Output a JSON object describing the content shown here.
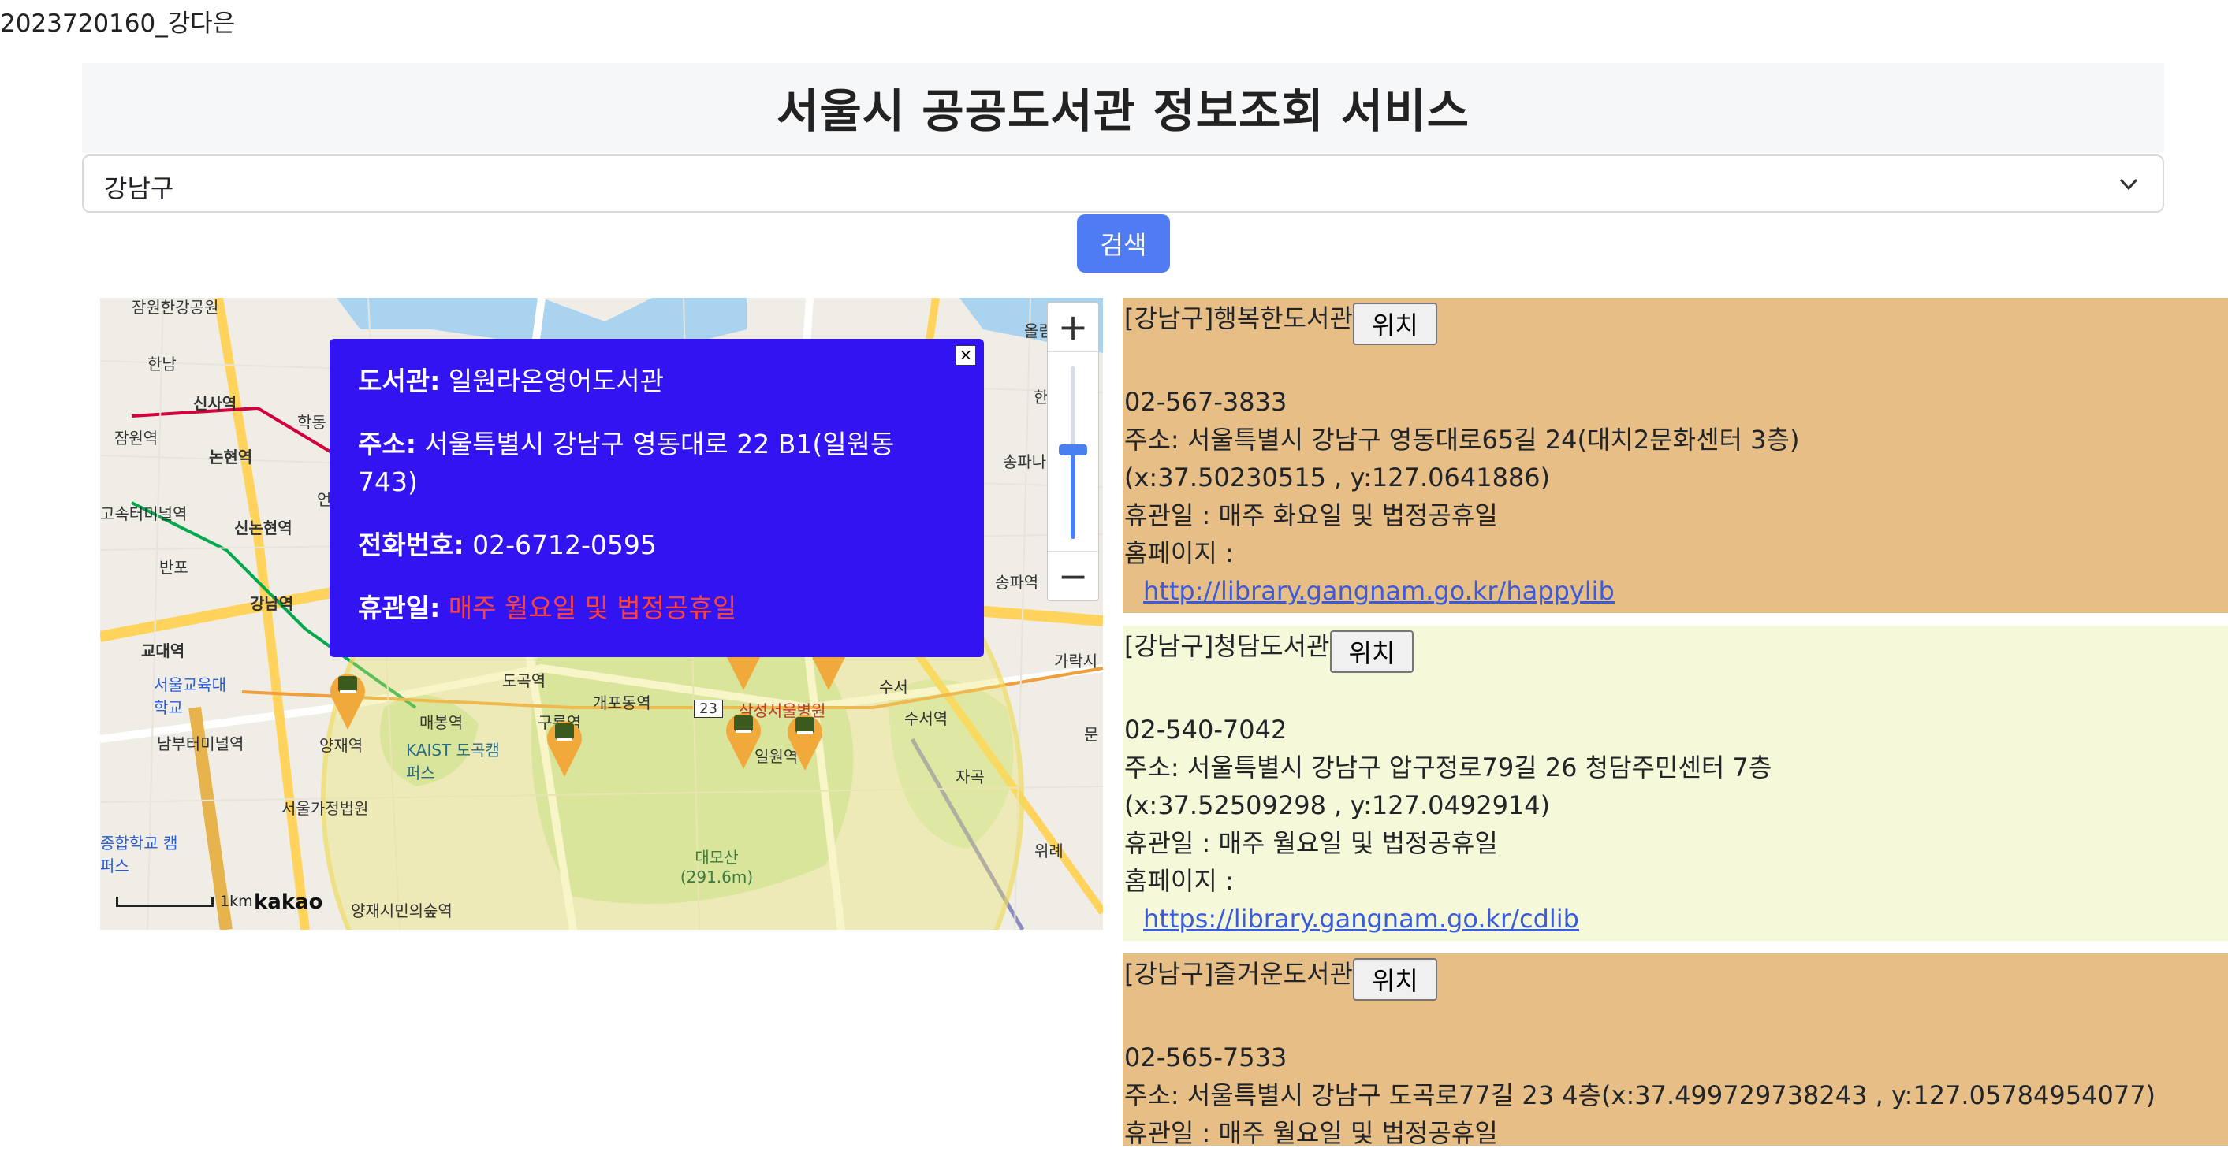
{
  "student": "2023720160_강다은",
  "header": {
    "title": "서울시 공공도서관 정보조회 서비스"
  },
  "district_select": {
    "value": "강남구",
    "chevron_icon": "chevron-down-icon"
  },
  "search_button": {
    "label": "검색"
  },
  "map": {
    "labels": [
      "잠원한강공원",
      "한남",
      "신사역",
      "학동",
      "잠원역",
      "논현역",
      "고속터미널역",
      "신논현역",
      "언",
      "반포",
      "강남역",
      "교대역",
      "서울교육대학교",
      "남부터미널역",
      "양재역",
      "서울가정법원",
      "KAIST 도곡캠퍼스",
      "매봉역",
      "도곡역",
      "구룡역",
      "개포동역",
      "삼성서울병원",
      "일원역",
      "수서역",
      "수서",
      "자곡",
      "가락시",
      "송파역",
      "송파나루",
      "위례",
      "대모산 (291.6m)",
      "양재시민의숲역",
      "문",
      "올림",
      "한",
      "종합학교 캠퍼스",
      "23"
    ],
    "scale_label": "1km",
    "brand": "kakao",
    "zoom_in_icon": "plus-icon",
    "zoom_out_icon": "minus-icon"
  },
  "popup": {
    "library_label": "도서관:",
    "library": "일원라온영어도서관",
    "address_label": "주소:",
    "address": "서울특별시 강남구 영동대로 22 B1(일원동 743)",
    "phone_label": "전화번호:",
    "phone": "02-6712-0595",
    "closed_label": "휴관일:",
    "closed": "매주 월요일 및 법정공휴일",
    "close_icon": "close-icon"
  },
  "libraries": [
    {
      "name": "[강남구]행복한도서관",
      "button": "위치",
      "phone": "02-567-3833",
      "address": "주소: 서울특별시 강남구 영동대로65길 24(대치2문화센터 3층)",
      "coords": "(x:37.50230515 , y:127.0641886)",
      "closed": "휴관일 : 매주 화요일 및 법정공휴일",
      "homepage_label": "홈페이지 :",
      "homepage": "http://library.gangnam.go.kr/happylib",
      "color": "#e6be86"
    },
    {
      "name": "[강남구]청담도서관",
      "button": "위치",
      "phone": "02-540-7042",
      "address": "주소: 서울특별시 강남구 압구정로79길 26 청담주민센터 7층",
      "coords": "(x:37.52509298 , y:127.0492914)",
      "closed": "휴관일 : 매주 월요일 및 법정공휴일",
      "homepage_label": "홈페이지 :",
      "homepage": "https://library.gangnam.go.kr/cdlib",
      "color": "#f6f9d9"
    },
    {
      "name": "[강남구]즐거운도서관",
      "button": "위치",
      "phone": "02-565-7533",
      "address": "주소: 서울특별시 강남구 도곡로77길 23 4층(x:37.499729738243 , y:127.05784954077)",
      "closed": "휴관일 : 매주 월요일 및 법정공휴일",
      "color": "#e6be86"
    }
  ]
}
